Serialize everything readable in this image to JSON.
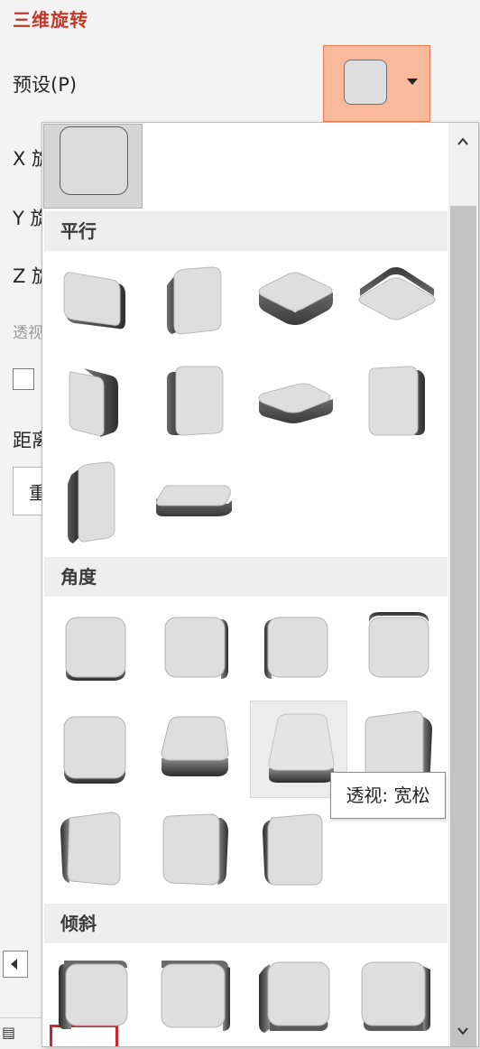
{
  "pane": {
    "title": "三维旋转",
    "preset_label": "预设(P)",
    "x_label_partial": "X 旋",
    "y_label_partial": "Y 旋",
    "z_label_partial": "Z 旋",
    "perspective_partial": "透视",
    "distance_partial": "距离",
    "reset_partial": "重"
  },
  "gallery": {
    "sections": [
      {
        "name": "平行",
        "preset_count": 10
      },
      {
        "name": "角度",
        "preset_count": 11
      },
      {
        "name": "倾斜",
        "preset_count": 4
      }
    ],
    "highlighted_section": "倾斜",
    "hovered_preset": "透视: 宽松"
  },
  "tooltip": {
    "text": "透视: 宽松"
  },
  "colors": {
    "accent": "#f9b99c",
    "highlight": "#d0232a",
    "title": "#c0392b"
  }
}
